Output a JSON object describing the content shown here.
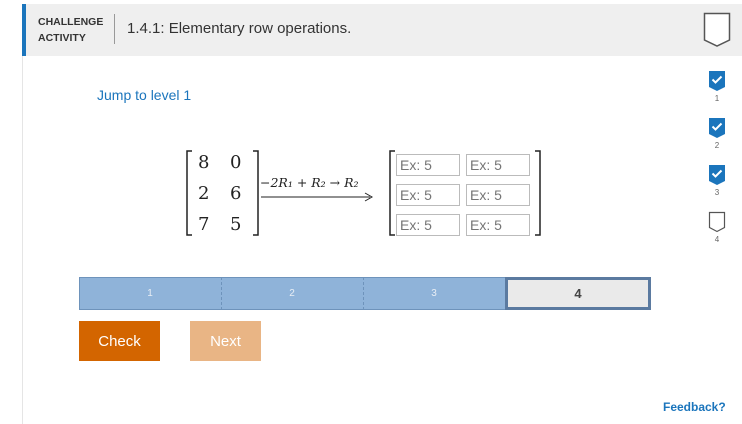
{
  "header": {
    "label_line1": "CHALLENGE",
    "label_line2": "ACTIVITY",
    "title": "1.4.1: Elementary row operations."
  },
  "jump_link": "Jump to level 1",
  "problem": {
    "matrix": [
      [
        "8",
        "0"
      ],
      [
        "2",
        "6"
      ],
      [
        "7",
        "5"
      ]
    ],
    "operation": "−2R₁ + R₂ → R₂",
    "answer_cells": [
      {
        "value": "",
        "placeholder": "Ex: 5"
      },
      {
        "value": "",
        "placeholder": "Ex: 5"
      },
      {
        "value": "",
        "placeholder": "Ex: 5"
      },
      {
        "value": "",
        "placeholder": "Ex: 5"
      },
      {
        "value": "",
        "placeholder": "Ex: 5"
      },
      {
        "value": "",
        "placeholder": "Ex: 5"
      }
    ]
  },
  "progress": {
    "levels": [
      "1",
      "2",
      "3",
      "4"
    ],
    "completed": 3,
    "current": "4"
  },
  "buttons": {
    "check": "Check",
    "next": "Next"
  },
  "level_checklist": [
    {
      "label": "1",
      "done": true
    },
    {
      "label": "2",
      "done": true
    },
    {
      "label": "3",
      "done": true
    },
    {
      "label": "4",
      "done": false
    }
  ],
  "feedback_link": "Feedback?",
  "colors": {
    "accent_blue": "#1b75bc",
    "check_orange": "#d36500",
    "next_light_orange": "#e9b585",
    "progress_fill": "#8fb3d9"
  }
}
